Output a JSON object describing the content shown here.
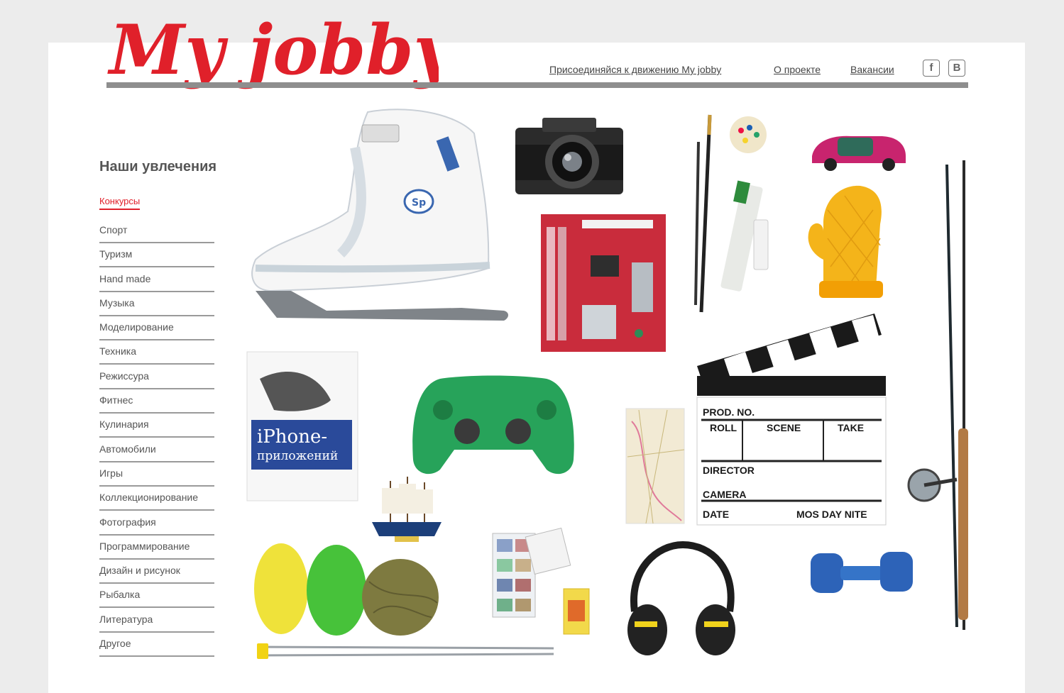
{
  "header": {
    "logo_text": "My jobby",
    "nav": [
      {
        "label": "Присоединяйся к движению My jobby"
      },
      {
        "label": "О проекте"
      },
      {
        "label": "Вакансии"
      }
    ],
    "social": [
      {
        "label": "f",
        "icon": "facebook-icon"
      },
      {
        "label": "B",
        "icon": "vkontakte-icon"
      }
    ]
  },
  "sidebar": {
    "title": "Наши увлечения",
    "active": "Конкурсы",
    "items": [
      "Спорт",
      "Туризм",
      "Hand made",
      "Музыка",
      "Моделирование",
      "Техника",
      "Режиссура",
      "Фитнес",
      "Кулинария",
      "Автомобили",
      "Игры",
      "Коллекционирование",
      "Фотография",
      "Программирование",
      "Дизайн и рисунок",
      "Рыбалка",
      "Литература",
      "Другое"
    ]
  },
  "collage": {
    "book": {
      "line1": "iPhone-",
      "line2": "приложений"
    },
    "clapper": {
      "prod_no": "PROD. NO.",
      "roll": "ROLL",
      "scene": "SCENE",
      "take": "TAKE",
      "director": "DIRECTOR",
      "camera": "CAMERA",
      "date": "DATE",
      "mos_day_nite": "MOS DAY NITE"
    },
    "skate_logo": "Sp"
  },
  "colors": {
    "brand_red": "#e0202a",
    "bar_gray": "#8e8e8e",
    "page_bg": "#ececec"
  }
}
